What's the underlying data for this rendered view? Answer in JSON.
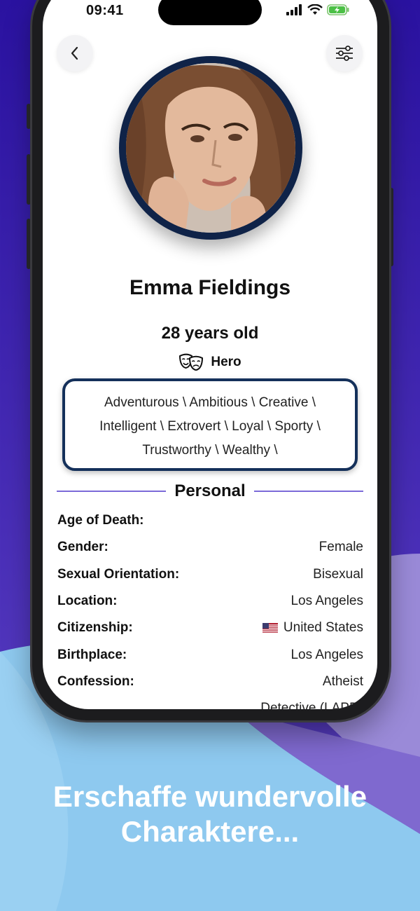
{
  "status_bar": {
    "time": "09:41"
  },
  "header": {
    "back_icon": "chevron-left-icon",
    "filter_icon": "sliders-icon"
  },
  "profile": {
    "name": "Emma Fieldings",
    "age": "28 years old",
    "role_icon": "theater-masks-icon",
    "role": "Hero",
    "traits_lines": [
      "Adventurous \\ Ambitious \\ Creative \\",
      "Intelligent \\ Extrovert \\ Loyal \\ Sporty \\",
      "Trustworthy \\ Wealthy \\"
    ]
  },
  "personal": {
    "title": "Personal",
    "rows": [
      {
        "label": "Age of Death:",
        "value": ""
      },
      {
        "label": "Gender:",
        "value": "Female"
      },
      {
        "label": "Sexual Orientation:",
        "value": "Bisexual"
      },
      {
        "label": "Location:",
        "value": "Los Angeles"
      },
      {
        "label": "Citizenship:",
        "value": "United States",
        "flag": "🇺🇸"
      },
      {
        "label": "Birthplace:",
        "value": "Los Angeles"
      },
      {
        "label": "Confession:",
        "value": "Atheist"
      },
      {
        "label": "",
        "value": "Detective (LAPD)"
      }
    ]
  },
  "caption": {
    "line1": "Erschaffe wundervolle",
    "line2": "Charaktere..."
  },
  "colors": {
    "accent": "#7b6ad8",
    "avatar_ring": "#0f2348",
    "traits_border": "#14305a",
    "bg_top": "#3a1fa8",
    "bg_bottom": "#88c8ee"
  }
}
